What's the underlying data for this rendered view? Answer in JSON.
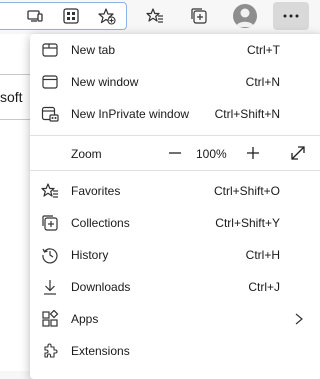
{
  "page": {
    "partial_text": "soft"
  },
  "toolbar": {
    "icons": [
      "immersive-reader-icon",
      "apps-icon",
      "add-favorite-icon",
      "favorites-icon",
      "collections-icon",
      "profile-avatar",
      "more-icon"
    ]
  },
  "menu": {
    "items": [
      {
        "label": "New tab",
        "shortcut": "Ctrl+T",
        "icon": "new-tab-icon"
      },
      {
        "label": "New window",
        "shortcut": "Ctrl+N",
        "icon": "new-window-icon"
      },
      {
        "label": "New InPrivate window",
        "shortcut": "Ctrl+Shift+N",
        "icon": "inprivate-icon"
      }
    ],
    "zoom": {
      "label": "Zoom",
      "value": "100%",
      "minus": "—",
      "plus": "+"
    },
    "items2": [
      {
        "label": "Favorites",
        "shortcut": "Ctrl+Shift+O",
        "icon": "favorites-icon"
      },
      {
        "label": "Collections",
        "shortcut": "Ctrl+Shift+Y",
        "icon": "collections-icon"
      },
      {
        "label": "History",
        "shortcut": "Ctrl+H",
        "icon": "history-icon"
      },
      {
        "label": "Downloads",
        "shortcut": "Ctrl+J",
        "icon": "downloads-icon"
      },
      {
        "label": "Apps",
        "shortcut": "",
        "icon": "apps-icon"
      },
      {
        "label": "Extensions",
        "shortcut": "",
        "icon": "extensions-icon"
      }
    ]
  },
  "colors": {
    "accent": "#0078d4",
    "menu_bg": "#ffffff",
    "toolbar_bg": "#f7f7f7",
    "more_btn_bg": "#d9d9d9"
  }
}
